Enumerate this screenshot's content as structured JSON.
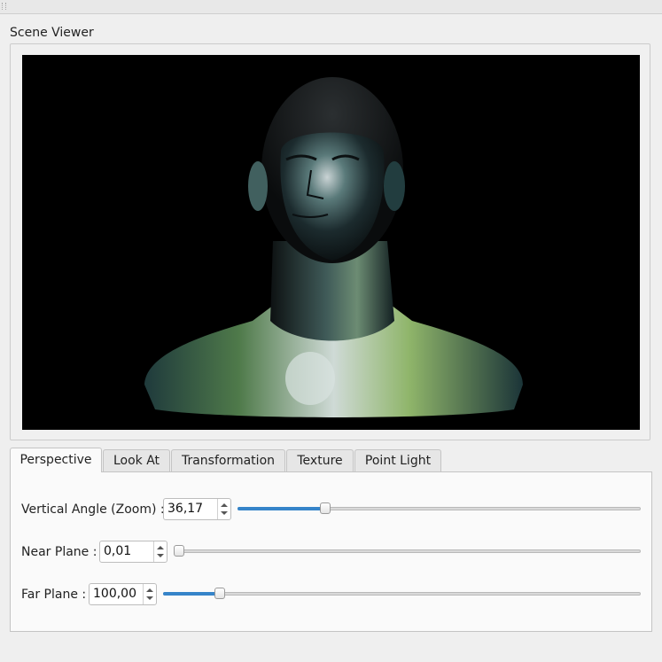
{
  "group": {
    "title": "Scene Viewer"
  },
  "viewport": {
    "content": "3D shaded head bust on black background",
    "background": "#000000"
  },
  "tabs": [
    {
      "label": "Perspective",
      "active": true
    },
    {
      "label": "Look At",
      "active": false
    },
    {
      "label": "Transformation",
      "active": false
    },
    {
      "label": "Texture",
      "active": false
    },
    {
      "label": "Point Light",
      "active": false
    }
  ],
  "perspective": {
    "vertical_angle": {
      "label": "Vertical Angle (Zoom) :",
      "value": "36,17",
      "slider_fraction": 0.21
    },
    "near_plane": {
      "label": "Near Plane :",
      "value": "0,01",
      "slider_fraction": 0.0
    },
    "far_plane": {
      "label": "Far Plane :",
      "value": "100,00",
      "slider_fraction": 0.11
    }
  },
  "colors": {
    "accent": "#3584c9",
    "window_bg": "#efefef"
  }
}
